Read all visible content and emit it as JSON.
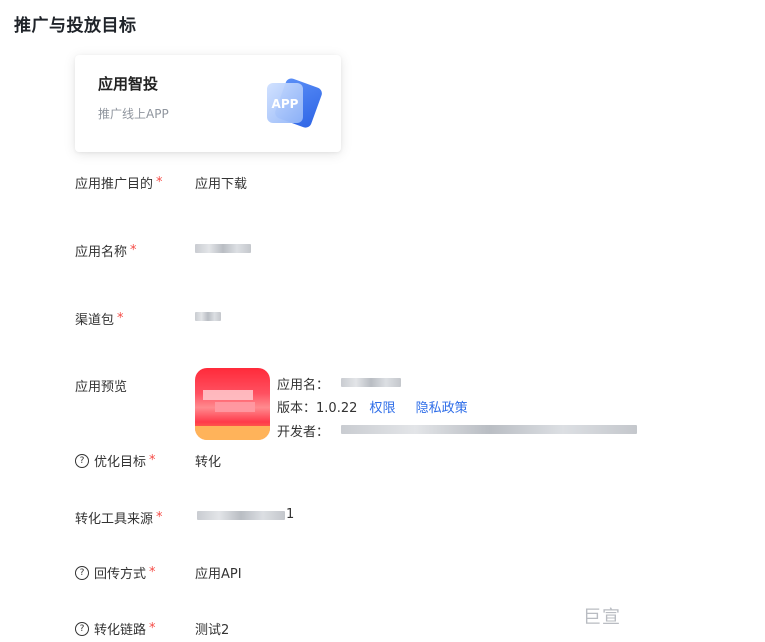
{
  "section": {
    "title": "推广与投放目标"
  },
  "card": {
    "title": "应用智投",
    "subtitle": "推广线上APP",
    "icon_text": "APP"
  },
  "form": {
    "promotion_goal": {
      "label": "应用推广目的",
      "value": "应用下载"
    },
    "app_name": {
      "label": "应用名称"
    },
    "channel_pkg": {
      "label": "渠道包"
    },
    "app_preview": {
      "label": "应用预览",
      "app_name_label": "应用名：",
      "version_label": "版本：",
      "version_value": "1.0.22",
      "permission_link": "权限",
      "privacy_link": "隐私政策",
      "developer_label": "开发者："
    },
    "optimize_goal": {
      "label": "优化目标",
      "value": "转化"
    },
    "conversion_tool": {
      "label": "转化工具来源",
      "value_suffix": "1"
    },
    "callback": {
      "label": "回传方式",
      "value": "应用API"
    },
    "conversion_link": {
      "label": "转化链路",
      "value": "测试2"
    }
  },
  "watermark": "巨宣",
  "colors": {
    "required": "#f54a45",
    "link": "#2f6ee8",
    "card_icon": "#3d7ff0"
  }
}
